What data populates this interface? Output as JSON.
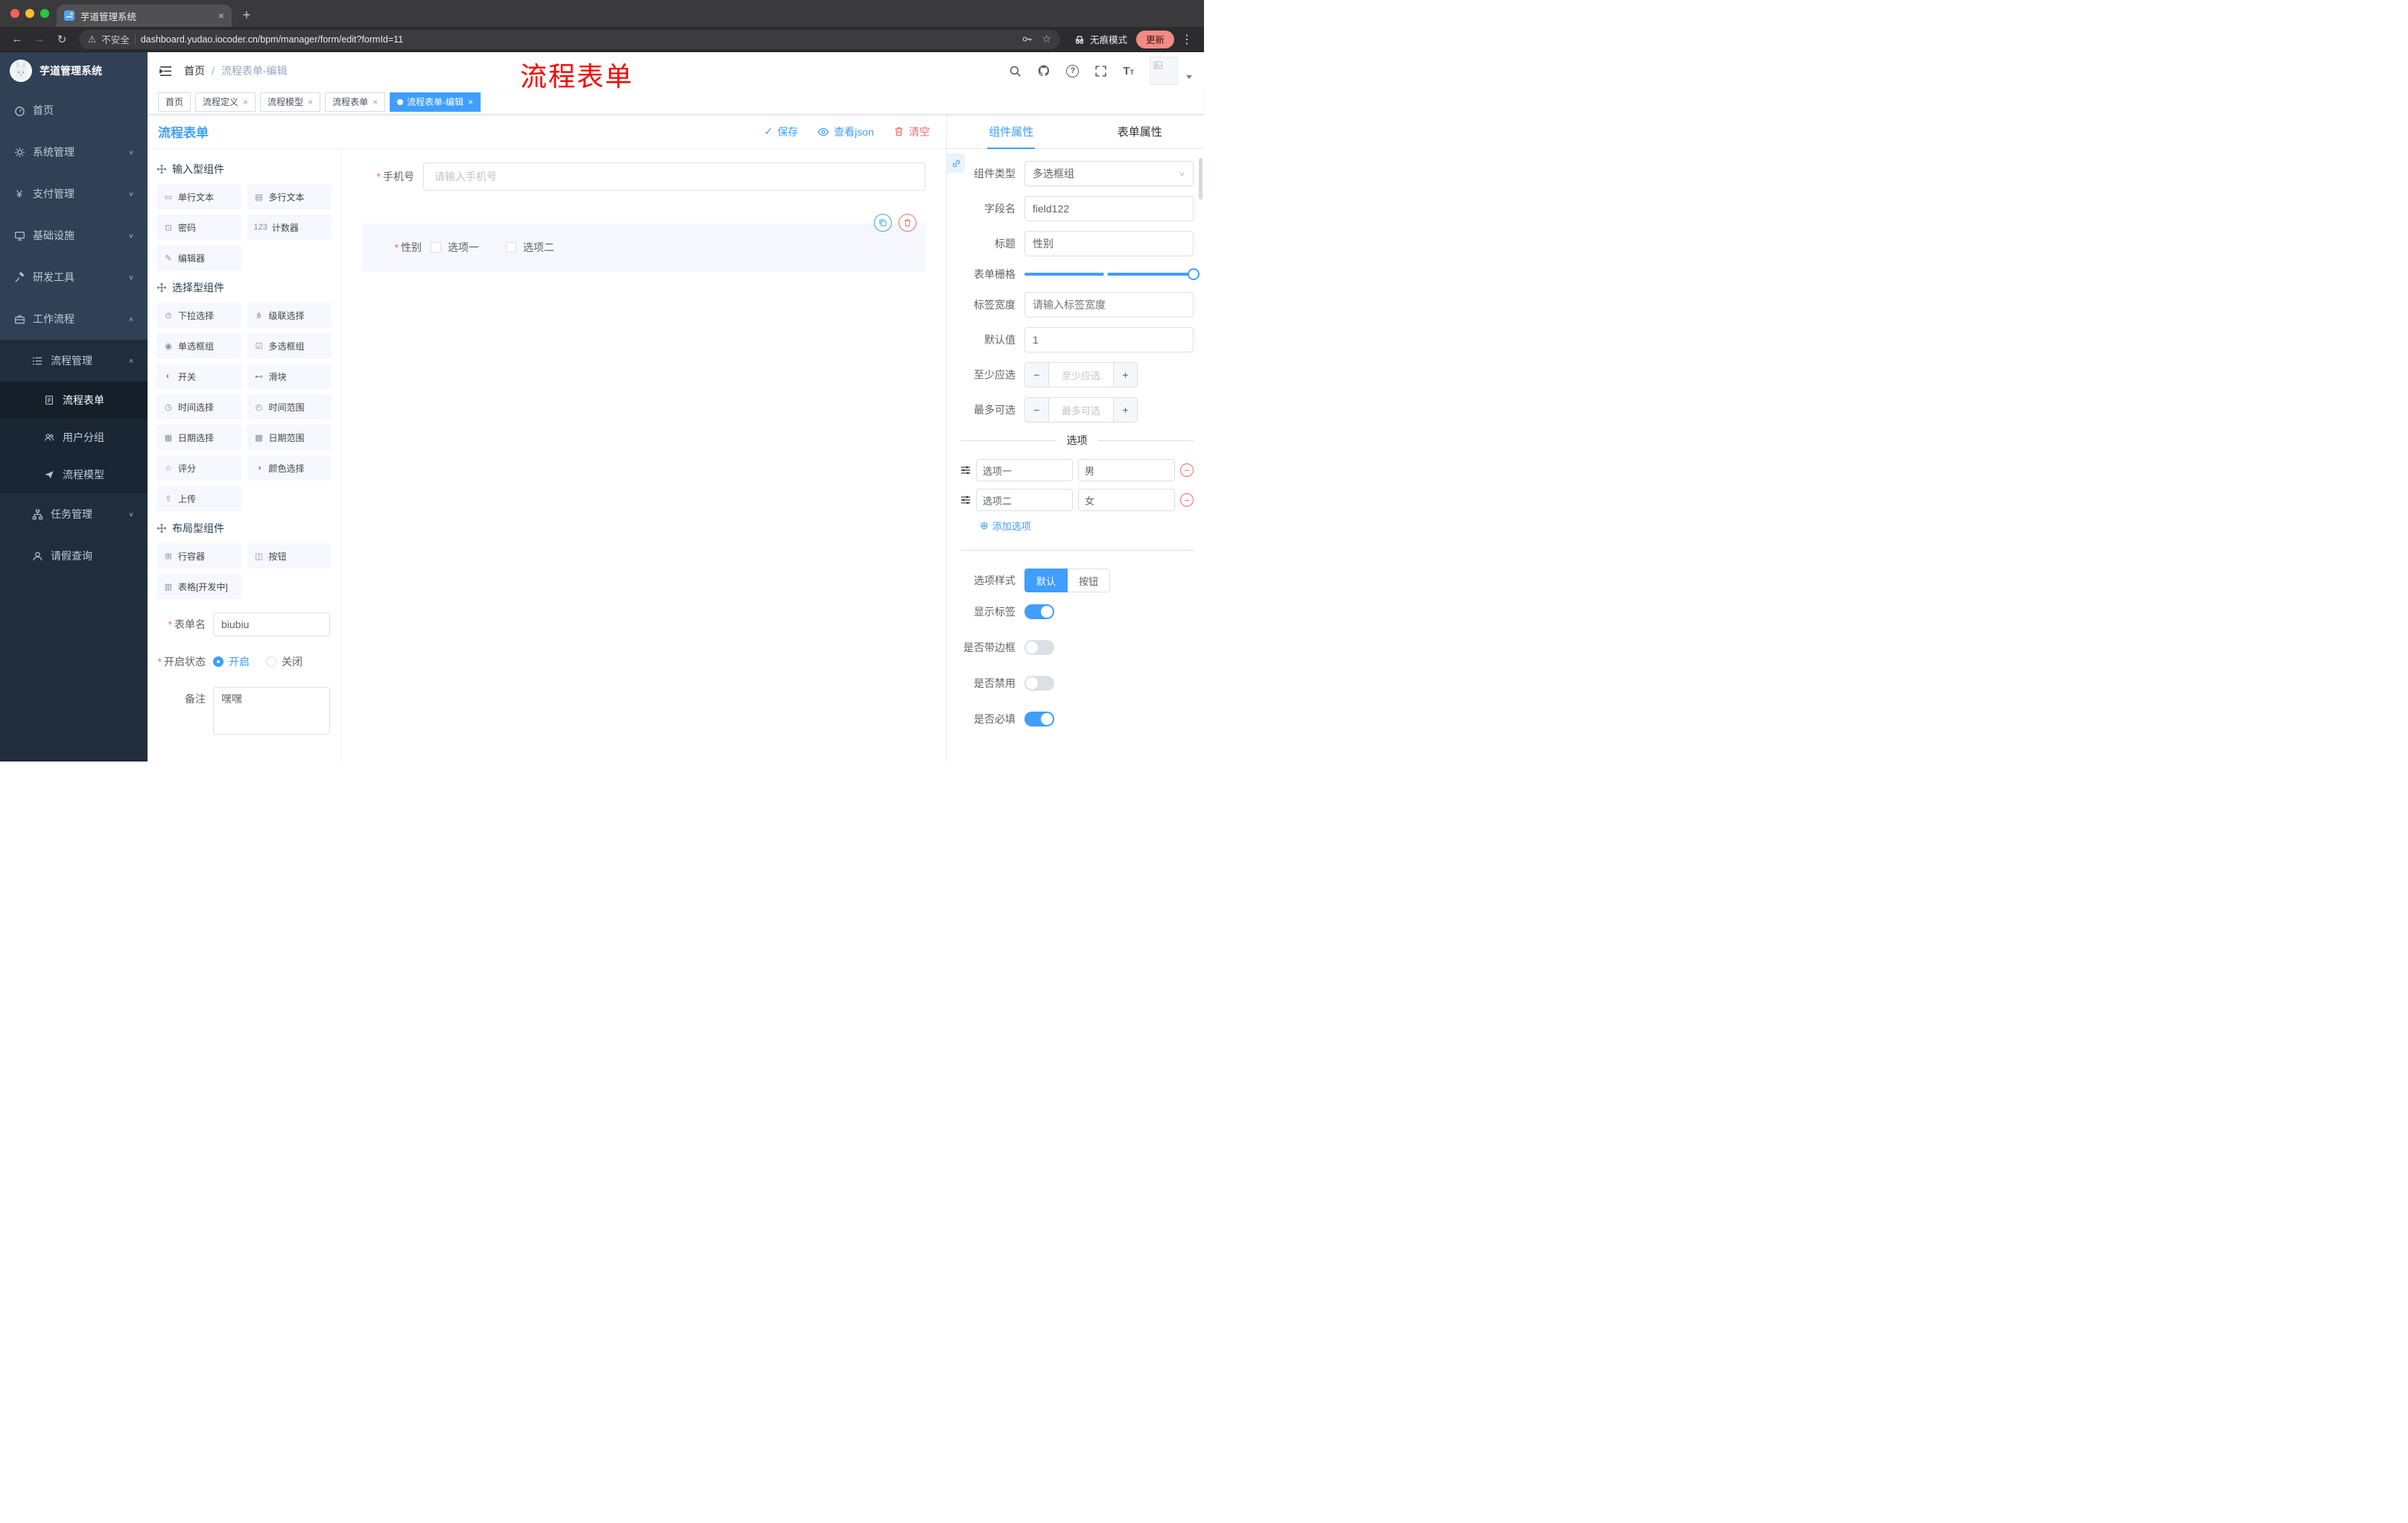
{
  "colors": {
    "accent": "#409eff",
    "danger": "#f56c6c",
    "annotation_red": "#ff0000",
    "sidebar_bg": "#304156",
    "sidebar_submenu_bg": "#1f2d3d",
    "tag_active_bg": "#409eff"
  },
  "ui": {
    "required_marker": "*",
    "breadcrumb_separator": "/"
  },
  "icons": {
    "back": "←",
    "forward": "→",
    "reload": "↻",
    "new_tab": "+",
    "close": "×",
    "menu_dots": "⋮",
    "warning": "⚠",
    "bookmark_star": "☆",
    "question": "?",
    "font_size": "T",
    "chevron_down": "∨",
    "chevron_up": "∧",
    "check": "✓",
    "plus": "+",
    "minus": "−",
    "add_circle": "⊕",
    "yen": "¥"
  },
  "browser": {
    "tab_title": "芋道管理系统",
    "security_label": "不安全",
    "url": "dashboard.yudao.iocoder.cn/bpm/manager/form/edit?formId=11",
    "incognito_label": "无痕模式",
    "update_label": "更新"
  },
  "annotation": {
    "text": "流程表单"
  },
  "sidebar": {
    "logo_title": "芋道管理系统",
    "items": [
      {
        "label": "首页"
      },
      {
        "label": "系统管理"
      },
      {
        "label": "支付管理"
      },
      {
        "label": "基础设施"
      },
      {
        "label": "研发工具"
      },
      {
        "label": "工作流程"
      },
      {
        "label": "流程管理"
      },
      {
        "label": "流程表单"
      },
      {
        "label": "用户分组"
      },
      {
        "label": "流程模型"
      },
      {
        "label": "任务管理"
      },
      {
        "label": "请假查询"
      }
    ]
  },
  "header": {
    "breadcrumb_home": "首页",
    "breadcrumb_current": "流程表单-编辑"
  },
  "tags": [
    {
      "label": "首页"
    },
    {
      "label": "流程定义"
    },
    {
      "label": "流程模型"
    },
    {
      "label": "流程表单"
    },
    {
      "label": "流程表单-编辑"
    }
  ],
  "designer": {
    "title": "流程表单",
    "actions": {
      "save": "保存",
      "view_json": "查看json",
      "clear": "清空"
    },
    "palette": {
      "sections": [
        {
          "title": "输入型组件",
          "items": [
            {
              "icon": "▭",
              "label": "单行文本"
            },
            {
              "icon": "▤",
              "label": "多行文本"
            },
            {
              "icon": "⊡",
              "label": "密码"
            },
            {
              "icon": "123",
              "label": "计数器"
            },
            {
              "icon": "✎",
              "label": "编辑器"
            }
          ]
        },
        {
          "title": "选择型组件",
          "items": [
            {
              "icon": "⊙",
              "label": "下拉选择"
            },
            {
              "icon": "⋔",
              "label": "级联选择"
            },
            {
              "icon": "◉",
              "label": "单选框组"
            },
            {
              "icon": "☑",
              "label": "多选框组"
            },
            {
              "icon": "◐",
              "label": "开关"
            },
            {
              "icon": "⊷",
              "label": "滑块"
            },
            {
              "icon": "◷",
              "label": "时间选择"
            },
            {
              "icon": "◴",
              "label": "时间范围"
            },
            {
              "icon": "▦",
              "label": "日期选择"
            },
            {
              "icon": "▩",
              "label": "日期范围"
            },
            {
              "icon": "☆",
              "label": "评分"
            },
            {
              "icon": "◑",
              "label": "颜色选择"
            },
            {
              "icon": "⇧",
              "label": "上传"
            }
          ]
        },
        {
          "title": "布局型组件",
          "items": [
            {
              "icon": "⊞",
              "label": "行容器"
            },
            {
              "icon": "◫",
              "label": "按钮"
            },
            {
              "icon": "▥",
              "label": "表格[开发中]"
            }
          ]
        }
      ]
    },
    "meta": {
      "name_label": "表单名",
      "name_value": "biubiu",
      "status_label": "开启状态",
      "status_on": "开启",
      "status_off": "关闭",
      "remark_label": "备注",
      "remark_value": "嘿嘿"
    },
    "canvas": {
      "phone_label": "手机号",
      "phone_placeholder": "请输入手机号",
      "gender_label": "性别",
      "gender_option1": "选项一",
      "gender_option2": "选项二"
    }
  },
  "props": {
    "tab_component": "组件属性",
    "tab_form": "表单属性",
    "component_type_label": "组件类型",
    "component_type_value": "多选框组",
    "field_name_label": "字段名",
    "field_name_value": "field122",
    "title_label": "标题",
    "title_value": "性别",
    "grid_label": "表单栅格",
    "label_width_label": "标签宽度",
    "label_width_placeholder": "请输入标签宽度",
    "default_label": "默认值",
    "default_value": "1",
    "min_label": "至少应选",
    "min_placeholder": "至少应选",
    "max_label": "最多可选",
    "max_placeholder": "最多可选",
    "options_title": "选项",
    "options": [
      {
        "label": "选项一",
        "value": "男"
      },
      {
        "label": "选项二",
        "value": "女"
      }
    ],
    "add_option_label": "添加选项",
    "style_label": "选项样式",
    "style_default": "默认",
    "style_button": "按钮",
    "switch_show_label": "显示标签",
    "switch_border": "是否带边框",
    "switch_disabled": "是否禁用",
    "switch_required": "是否必填"
  }
}
